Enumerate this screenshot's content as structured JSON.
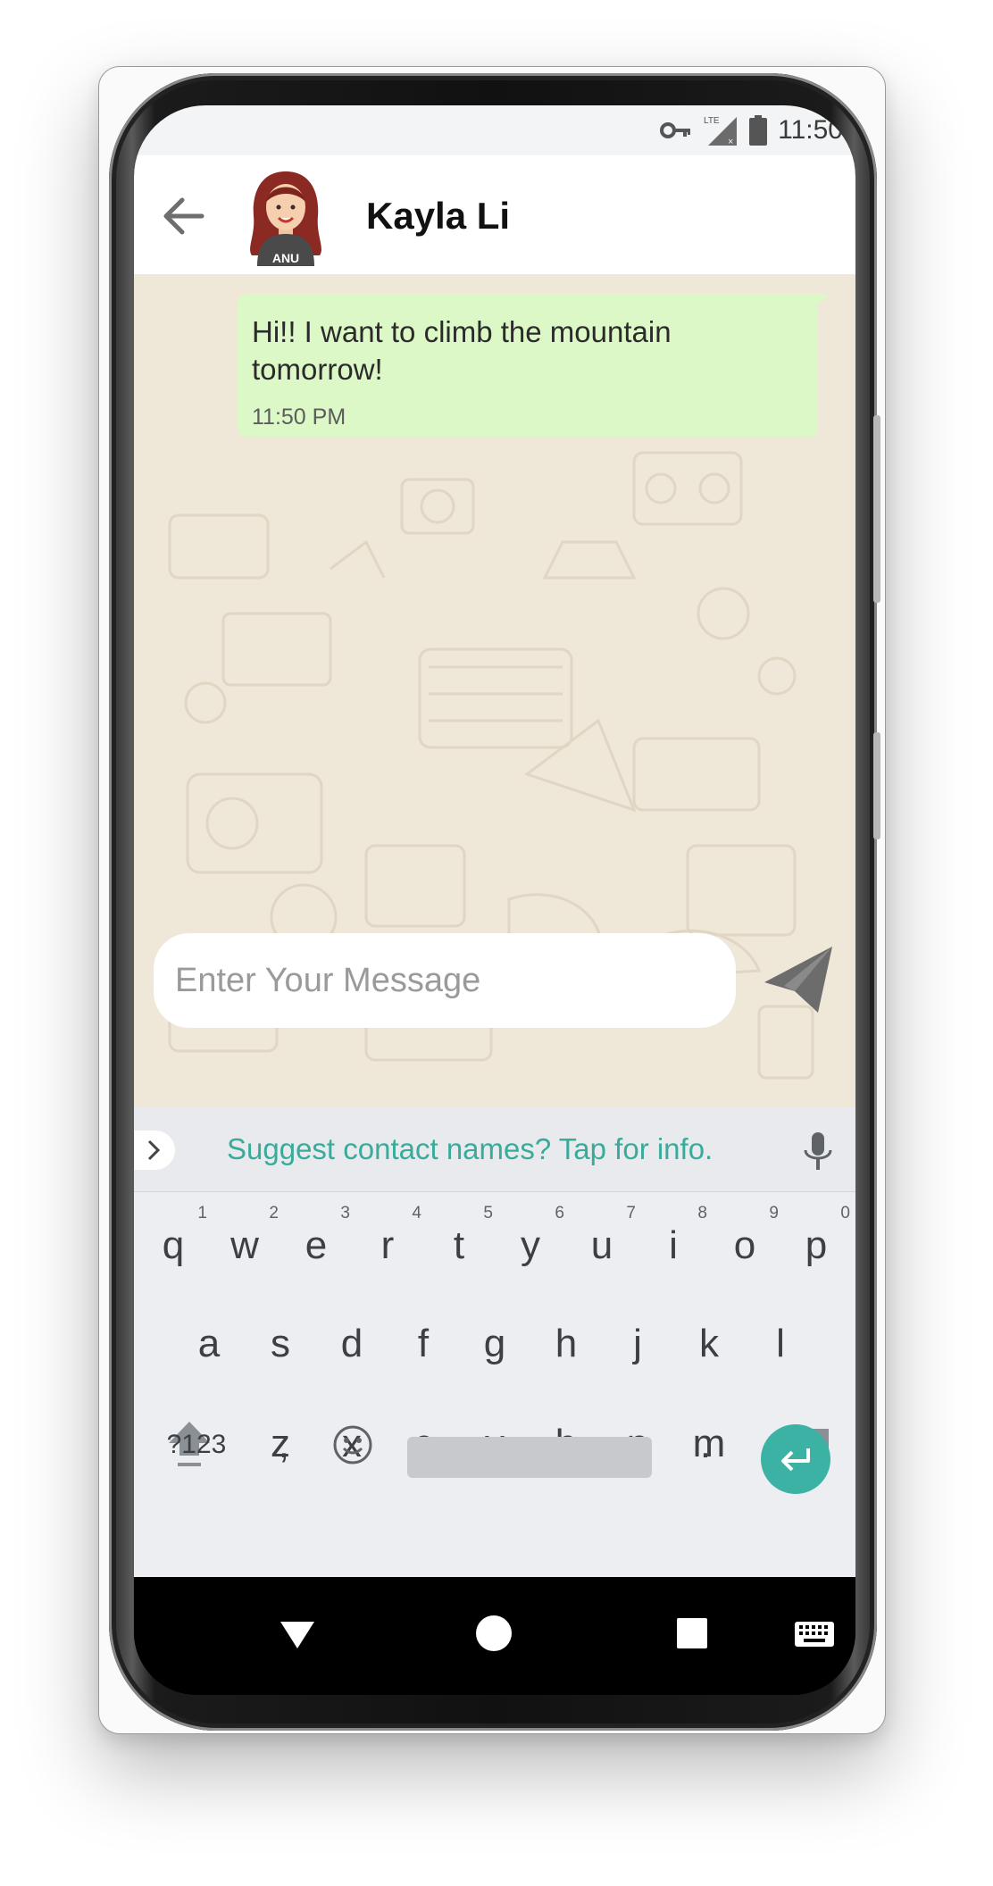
{
  "status_bar": {
    "time": "11:50",
    "network": "LTE",
    "icons": [
      "vpn-key-icon",
      "signal-icon",
      "battery-icon"
    ]
  },
  "header": {
    "back_icon": "arrow-left-icon",
    "contact_name": "Kayla Li",
    "avatar_shirt_text": "ANU"
  },
  "chat": {
    "messages": [
      {
        "text": "Hi!! I want to climb the mountain tomorrow!",
        "time": "11:50 PM",
        "direction": "outgoing",
        "color": "#dcf8c6"
      }
    ],
    "background_color": "#efe7d8"
  },
  "composer": {
    "placeholder": "Enter Your Message",
    "send_icon": "paper-plane-icon"
  },
  "keyboard": {
    "suggestion": "Suggest contact names? Tap for info.",
    "accent": "#3cb2a4",
    "row1": [
      "q",
      "w",
      "e",
      "r",
      "t",
      "y",
      "u",
      "i",
      "o",
      "p"
    ],
    "row1_hints": [
      "1",
      "2",
      "3",
      "4",
      "5",
      "6",
      "7",
      "8",
      "9",
      "0"
    ],
    "row2": [
      "a",
      "s",
      "d",
      "f",
      "g",
      "h",
      "j",
      "k",
      "l"
    ],
    "row3": [
      "z",
      "x",
      "c",
      "v",
      "b",
      "n",
      "m"
    ],
    "symbols_label": "?123",
    "comma": ",",
    "period": "."
  },
  "navbar": {
    "icons": [
      "back-triangle-icon",
      "home-circle-icon",
      "recents-square-icon",
      "keyboard-icon"
    ]
  }
}
